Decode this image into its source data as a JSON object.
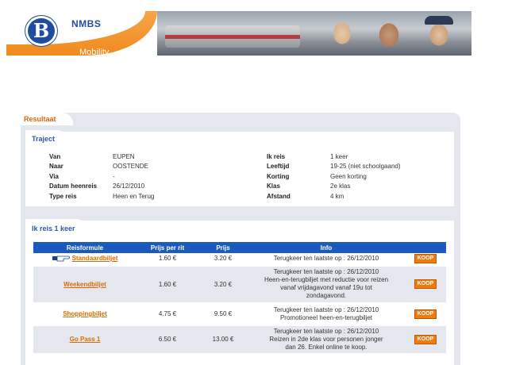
{
  "brand": {
    "name": "NMBS",
    "sub": "Mobility",
    "logo_letter": "B",
    "accent": "#f08a1c",
    "blue": "#1f4c9e"
  },
  "result": {
    "title": "Resultaat"
  },
  "traject": {
    "title": "Traject",
    "left": [
      {
        "k": "Van",
        "v": "EUPEN"
      },
      {
        "k": "Naar",
        "v": "OOSTENDE"
      },
      {
        "k": "Via",
        "v": "-"
      },
      {
        "k": "Datum heenreis",
        "v": "26/12/2010"
      },
      {
        "k": "Type reis",
        "v": "Heen en Terug"
      }
    ],
    "right": [
      {
        "k": "Ik reis",
        "v": "1 keer"
      },
      {
        "k": "Leeftijd",
        "v": "19-25 (niet schoolgaand)"
      },
      {
        "k": "Korting",
        "v": "Geen korting"
      },
      {
        "k": "Klas",
        "v": "2e klas"
      },
      {
        "k": "Afstand",
        "v": "4 km"
      }
    ]
  },
  "reis": {
    "title": "Ik reis 1 keer",
    "headers": [
      "Reisformule",
      "Prijs per rit",
      "Prijs",
      "Info"
    ],
    "rows": [
      {
        "formula": "Standaardbiljet",
        "pointer": "hand-pointer-icon",
        "per_rit": "1.60 €",
        "prijs": "3.20 €",
        "info": [
          "Terugkeer ten laatste op : 26/12/2010"
        ],
        "koop": "KOOP"
      },
      {
        "formula": "Weekendbiljet",
        "per_rit": "1.60 €",
        "prijs": "3.20 €",
        "info": [
          "Terugkeer ten laatste op : 26/12/2010",
          "Heen-en-terugbiljet met reductie voor reizen",
          "vanaf vrijdagavond vanaf 19u tot",
          "zondagavond."
        ],
        "koop": "KOOP"
      },
      {
        "formula": "Shoppingbiljet",
        "per_rit": "4.75 €",
        "prijs": "9.50 €",
        "info": [
          "Terugkeer ten laatste op : 26/12/2010",
          "Promotioneel heen-en-terugbiljet"
        ],
        "koop": "KOOP"
      },
      {
        "formula": "Go Pass 1",
        "per_rit": "6.50 €",
        "prijs": "13.00 €",
        "info": [
          "Terugkeer ten laatste op : 26/12/2010",
          "Reizen in 2de klas voor personen jonger",
          "dan 26. Enkel online te koop."
        ],
        "koop": "KOOP"
      }
    ]
  }
}
